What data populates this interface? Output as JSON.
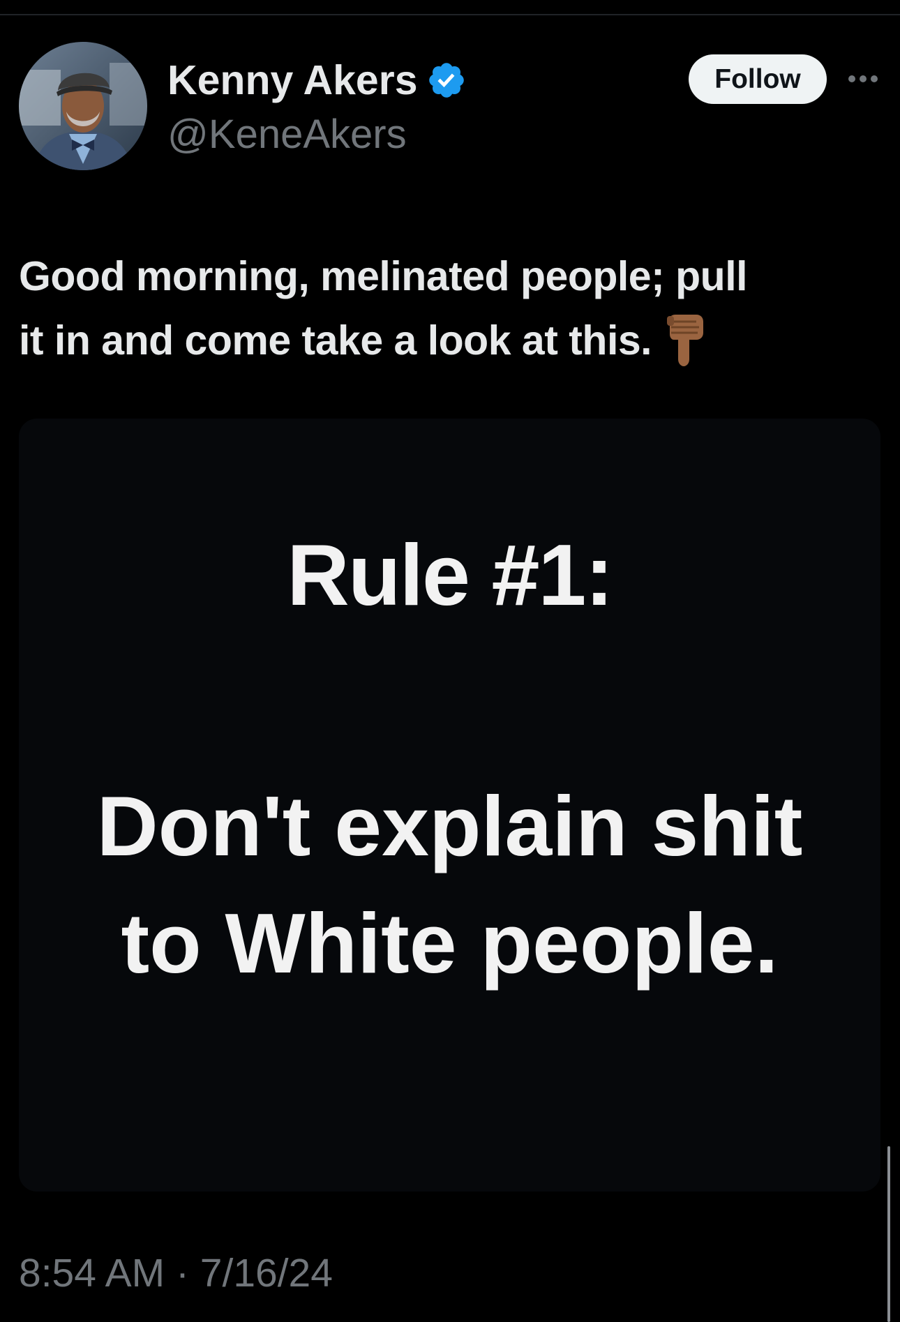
{
  "author": {
    "display_name": "Kenny Akers",
    "handle": "@KeneAkers",
    "verified": true,
    "verified_color": "#1d9bf0"
  },
  "actions": {
    "follow_label": "Follow",
    "more_label": "···"
  },
  "tweet": {
    "text_line1": "Good morning, melinated people; pull",
    "text_line2": "it in and come take a look at this.",
    "emoji_icon": "backhand-index-pointing-down-icon"
  },
  "media": {
    "rule_title": "Rule #1:",
    "rule_line1": "Don't explain shit",
    "rule_line2": "to White people."
  },
  "meta": {
    "timestamp": "8:54 AM · 7/16/24"
  },
  "colors": {
    "background": "#000000",
    "primary_text": "#e7e9ea",
    "secondary_text": "#71767b",
    "follow_button_bg": "#eff3f4"
  }
}
